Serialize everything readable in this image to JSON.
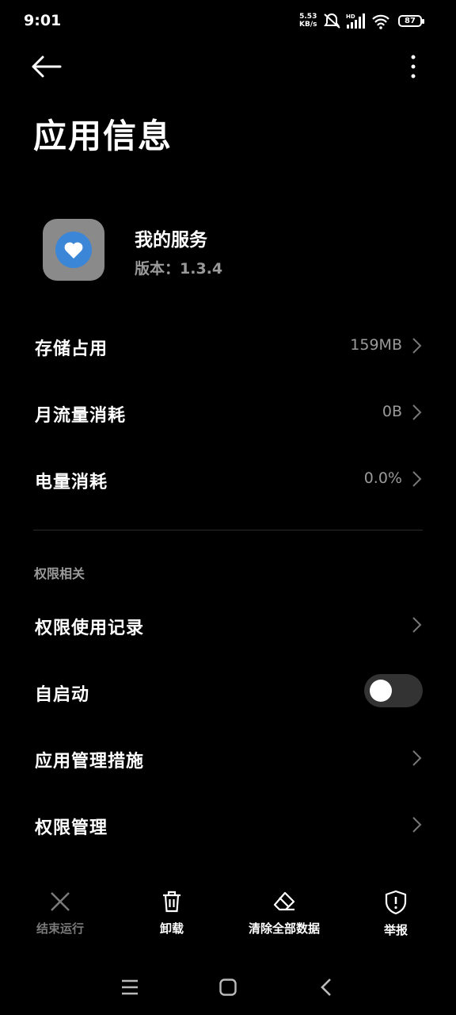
{
  "status_bar": {
    "time": "9:01",
    "net_speed": "5.53",
    "net_unit": "KB/s",
    "battery": "87",
    "hd": "HD"
  },
  "header": {
    "title": "应用信息"
  },
  "app": {
    "name": "我的服务",
    "version": "版本：1.3.4"
  },
  "rows": [
    {
      "label": "存储占用",
      "value": "159MB"
    },
    {
      "label": "月流量消耗",
      "value": "0B"
    },
    {
      "label": "电量消耗",
      "value": "0.0%"
    }
  ],
  "section_permissions": {
    "title": "权限相关"
  },
  "perm_rows": [
    {
      "label": "权限使用记录"
    },
    {
      "label": "自启动",
      "toggle_on": false
    },
    {
      "label": "应用管理措施"
    },
    {
      "label": "权限管理"
    }
  ],
  "actions": [
    {
      "label": "结束运行",
      "icon": "close-icon",
      "enabled": false
    },
    {
      "label": "卸载",
      "icon": "trash-icon",
      "enabled": true
    },
    {
      "label": "清除全部数据",
      "icon": "eraser-icon",
      "enabled": true
    },
    {
      "label": "举报",
      "icon": "shield-alert-icon",
      "enabled": true
    }
  ],
  "colors": {
    "background": "#000000",
    "secondary_text": "#9a9a9a",
    "app_icon_bg": "#8a8a8a",
    "app_icon_accent": "#3b86d6"
  }
}
